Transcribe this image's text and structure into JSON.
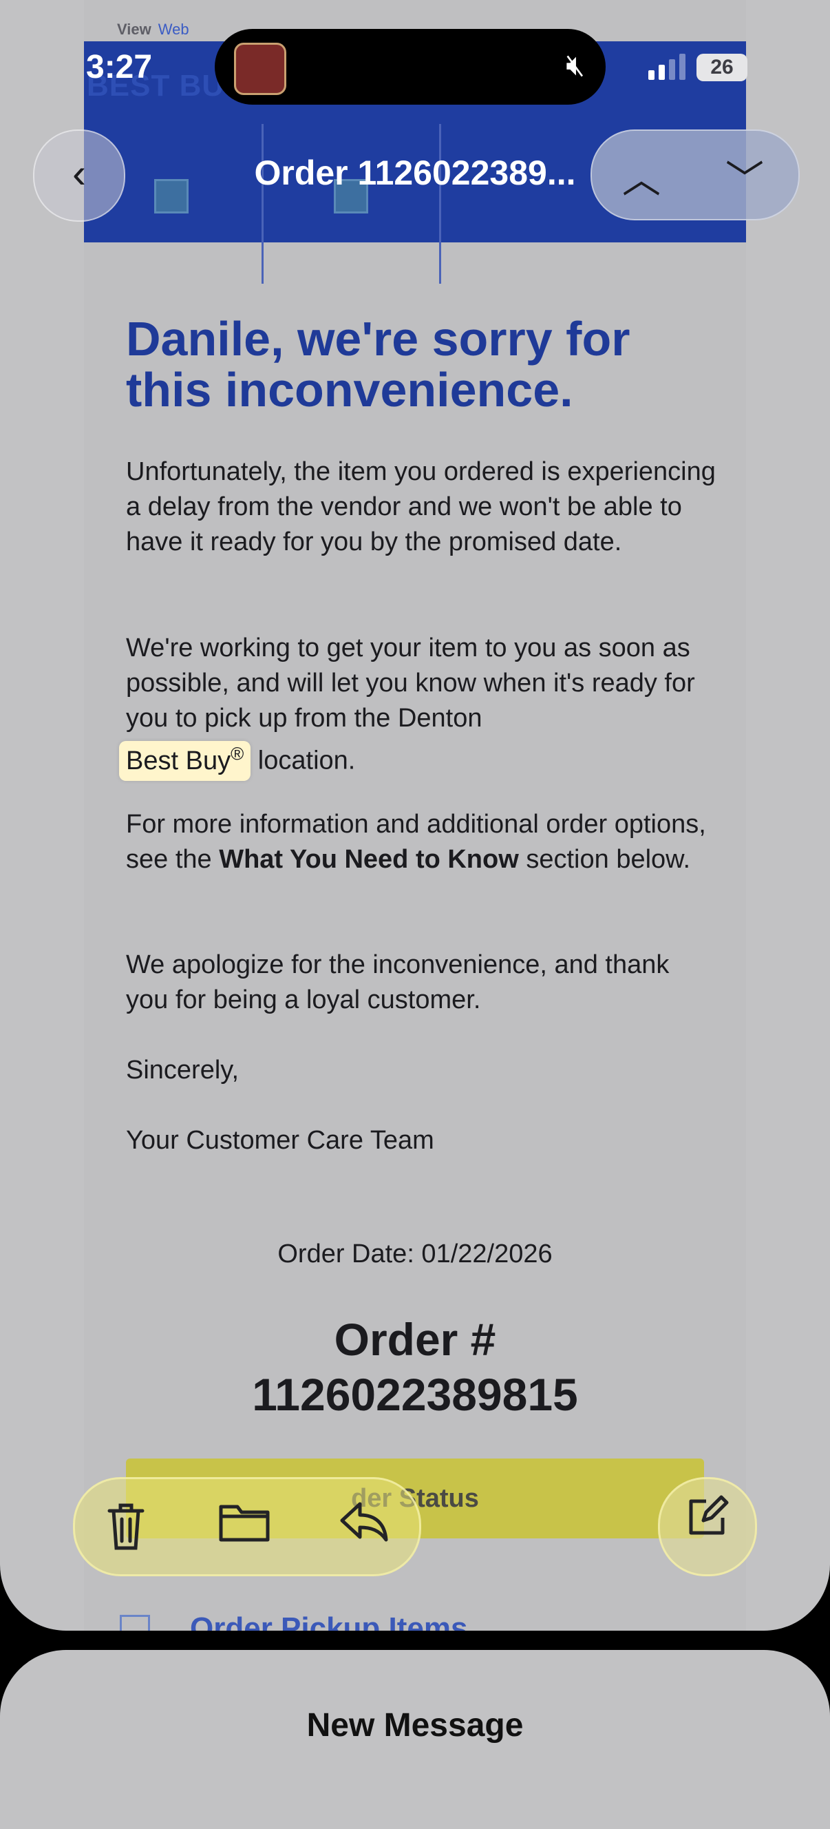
{
  "status_bar": {
    "time": "3:27",
    "battery": "26"
  },
  "nav": {
    "title": "Order 1126022389...",
    "back_glyph": "‹",
    "up_glyph": "︿",
    "down_glyph": "﹀"
  },
  "email": {
    "view_label": "View",
    "view_link": "Web",
    "brand": "BEST BUY",
    "headline": "Danile, we're sorry for this inconvenience.",
    "p1": "Unfortunately, the item you ordered is experiencing a delay from the vendor and we won't be able to have it ready for you by the promised date.",
    "p2_before": "We're working to get your item to you as soon as possible, and will let you know when it's ready for you to pick up from the Denton",
    "p2_link": "Best Buy",
    "p2_reg": "®",
    "p2_after": " location.",
    "p3_before": "For more information and additional order options, see the ",
    "p3_bold": "What You Need to Know",
    "p3_after": " section below.",
    "p4": "We apologize for the inconvenience, and thank you for being a loyal customer.",
    "p5": "Sincerely,",
    "p6": "Your Customer Care Team",
    "order_date": "Order Date: 01/22/2026",
    "order_label": "Order #",
    "order_number": "1126022389815",
    "status_button": "der Status",
    "pickup_link": "Order Pickup Items"
  },
  "toolbar": {
    "delete_icon": "trash-icon",
    "folder_icon": "folder-icon",
    "reply_icon": "reply-icon",
    "compose_icon": "compose-icon"
  },
  "new_message": {
    "label": "New Message"
  }
}
